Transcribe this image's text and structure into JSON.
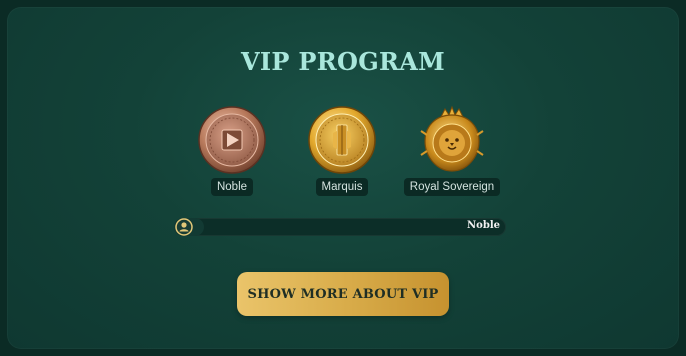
{
  "title": "VIP PROGRAM",
  "tiers": [
    {
      "label": "Noble",
      "icon": "bronze-medal-icon"
    },
    {
      "label": "Marquis",
      "icon": "gold-medal-icon"
    },
    {
      "label": "Royal Sovereign",
      "icon": "lion-crest-icon"
    }
  ],
  "progress": {
    "current_level": "Noble",
    "avatar_icon": "user-icon",
    "fraction": 0.09
  },
  "cta": {
    "label": "SHOW MORE ABOUT VIP"
  },
  "colors": {
    "background": "#134238",
    "title": "#a9e7dc",
    "gold": "#d9ad4b",
    "bronze": "#b97a5e"
  }
}
